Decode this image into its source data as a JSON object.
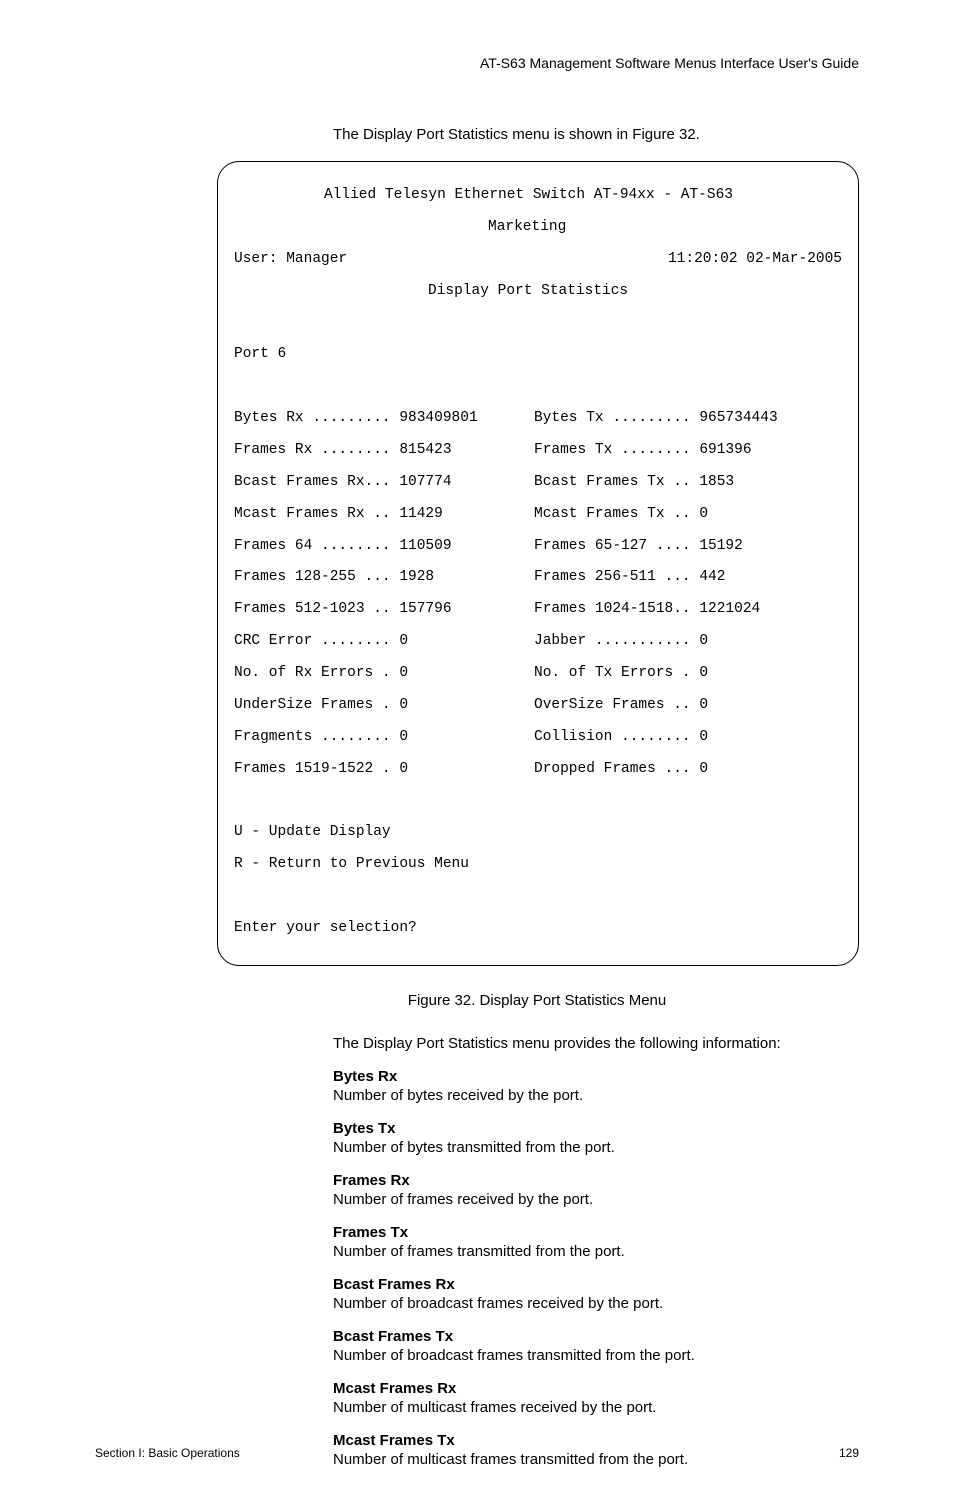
{
  "header": {
    "guide_title": "AT-S63 Management Software Menus Interface User's Guide"
  },
  "intro": "The Display Port Statistics menu is shown in Figure 32.",
  "terminal": {
    "banner_line1": "Allied Telesyn Ethernet Switch AT-94xx - AT-S63",
    "banner_line2": "Marketing",
    "user_label": "User: Manager",
    "datetime": "11:20:02 02-Mar-2005",
    "screen_title": "Display Port Statistics",
    "port_label": "Port 6",
    "stats_left": [
      "Bytes Rx ......... 983409801",
      "Frames Rx ........ 815423",
      "Bcast Frames Rx... 107774",
      "Mcast Frames Rx .. 11429",
      "Frames 64 ........ 110509",
      "Frames 128-255 ... 1928",
      "Frames 512-1023 .. 157796",
      "CRC Error ........ 0",
      "No. of Rx Errors . 0",
      "UnderSize Frames . 0",
      "Fragments ........ 0",
      "Frames 1519-1522 . 0"
    ],
    "stats_right": [
      "Bytes Tx ......... 965734443",
      "Frames Tx ........ 691396",
      "Bcast Frames Tx .. 1853",
      "Mcast Frames Tx .. 0",
      "Frames 65-127 .... 15192",
      "Frames 256-511 ... 442",
      "Frames 1024-1518.. 1221024",
      "Jabber ........... 0",
      "No. of Tx Errors . 0",
      "OverSize Frames .. 0",
      "Collision ........ 0",
      "Dropped Frames ... 0"
    ],
    "menu_u": "U - Update Display",
    "menu_r": "R - Return to Previous Menu",
    "prompt": "Enter your selection?"
  },
  "caption": "Figure 32. Display Port Statistics Menu",
  "body_line": "The Display Port Statistics menu provides the following information:",
  "definitions": [
    {
      "term": "Bytes Rx",
      "desc": "Number of bytes received by the port."
    },
    {
      "term": "Bytes Tx",
      "desc": "Number of bytes transmitted from the port."
    },
    {
      "term": "Frames Rx",
      "desc": "Number of frames received by the port."
    },
    {
      "term": "Frames Tx",
      "desc": "Number of frames transmitted from the port."
    },
    {
      "term": "Bcast Frames Rx",
      "desc": "Number of broadcast frames received by the port."
    },
    {
      "term": "Bcast Frames Tx",
      "desc": "Number of broadcast frames transmitted from the port."
    },
    {
      "term": "Mcast Frames Rx",
      "desc": "Number of multicast frames received by the port."
    },
    {
      "term": "Mcast Frames Tx",
      "desc": "Number of multicast frames transmitted from the port."
    }
  ],
  "footer": {
    "section": "Section I: Basic Operations",
    "page": "129"
  }
}
